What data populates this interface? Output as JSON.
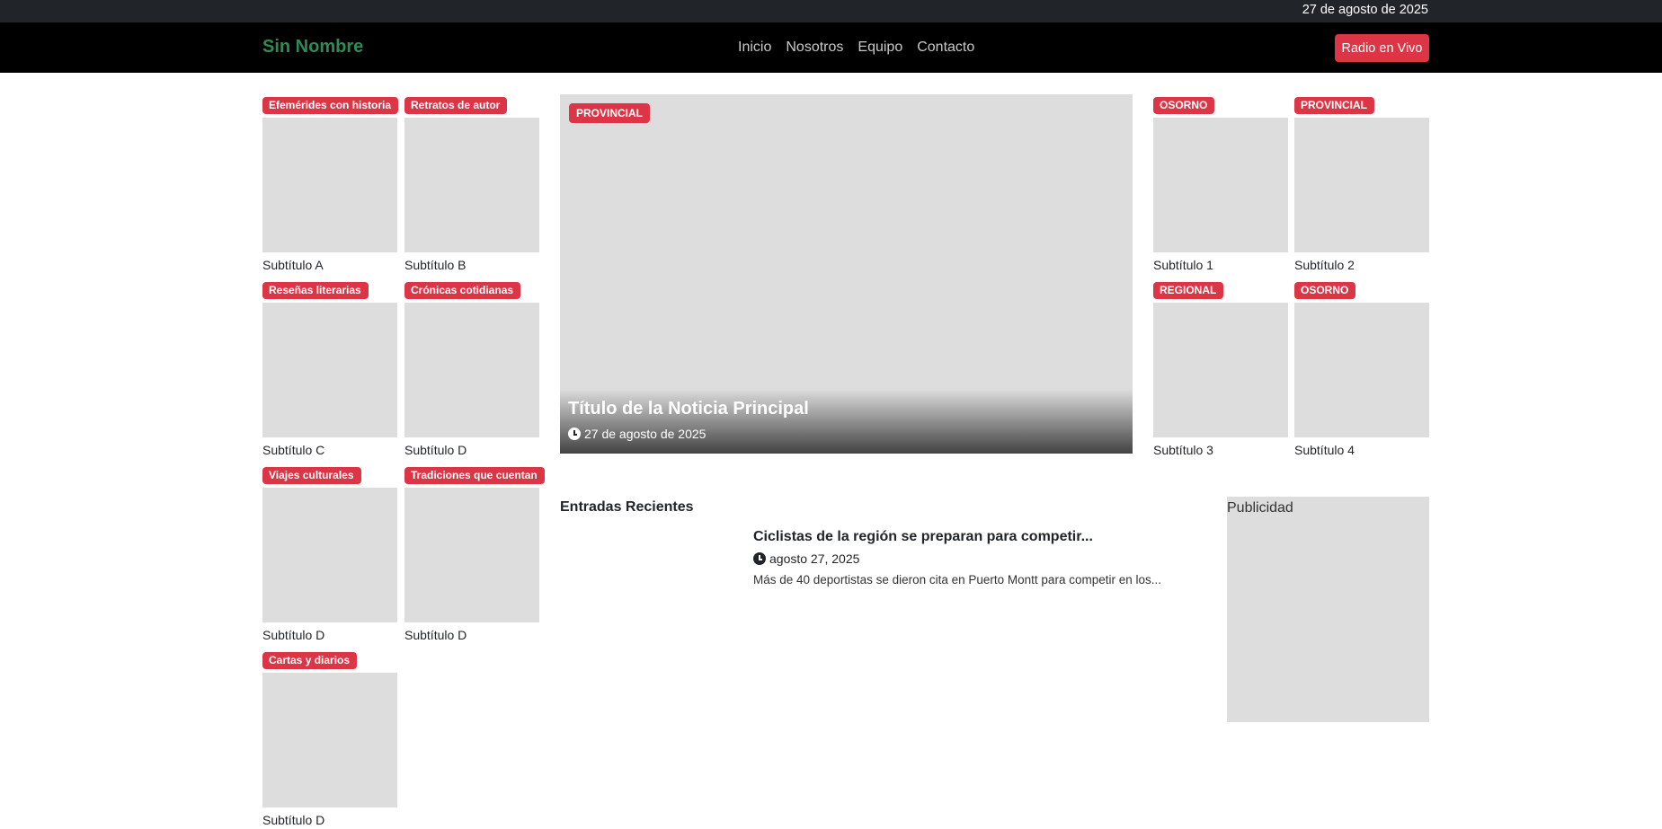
{
  "topbar": {
    "date": "27 de agosto de 2025"
  },
  "navbar": {
    "brand": "Sin Nombre",
    "links": [
      "Inicio",
      "Nosotros",
      "Equipo",
      "Contacto"
    ],
    "live_button": "Radio en Vivo"
  },
  "left_cards": [
    {
      "badge": "Efemérides con historia",
      "subtitle": "Subtítulo A"
    },
    {
      "badge": "Retratos de autor",
      "subtitle": "Subtítulo B"
    },
    {
      "badge": "Reseñas literarias",
      "subtitle": "Subtítulo C"
    },
    {
      "badge": "Crónicas cotidianas",
      "subtitle": "Subtítulo D"
    },
    {
      "badge": "Viajes culturales",
      "subtitle": "Subtítulo D"
    },
    {
      "badge": "Tradiciones que cuentan",
      "subtitle": "Subtítulo D"
    },
    {
      "badge": "Cartas y diarios",
      "subtitle": "Subtítulo D"
    }
  ],
  "hero": {
    "badge": "PROVINCIAL",
    "title": "Título de la Noticia Principal",
    "date": "27 de agosto de 2025"
  },
  "right_cards": [
    {
      "badge": "OSORNO",
      "subtitle": "Subtítulo 1"
    },
    {
      "badge": "PROVINCIAL",
      "subtitle": "Subtítulo 2"
    },
    {
      "badge": "REGIONAL",
      "subtitle": "Subtítulo 3"
    },
    {
      "badge": "OSORNO",
      "subtitle": "Subtítulo 4"
    }
  ],
  "recent": {
    "heading": "Entradas Recientes",
    "posts": [
      {
        "title": "Ciclistas de la región se preparan para competir...",
        "date": "agosto 27, 2025",
        "excerpt": "Más de 40 deportistas se dieron cita en Puerto Montt para competir en los..."
      }
    ]
  },
  "ad": {
    "label": "Publicidad"
  },
  "colors": {
    "badge": "#dc3545",
    "brand": "#2e8b57",
    "placeholder": "#dddddd",
    "topbar": "#212529",
    "navbar": "#000000"
  }
}
